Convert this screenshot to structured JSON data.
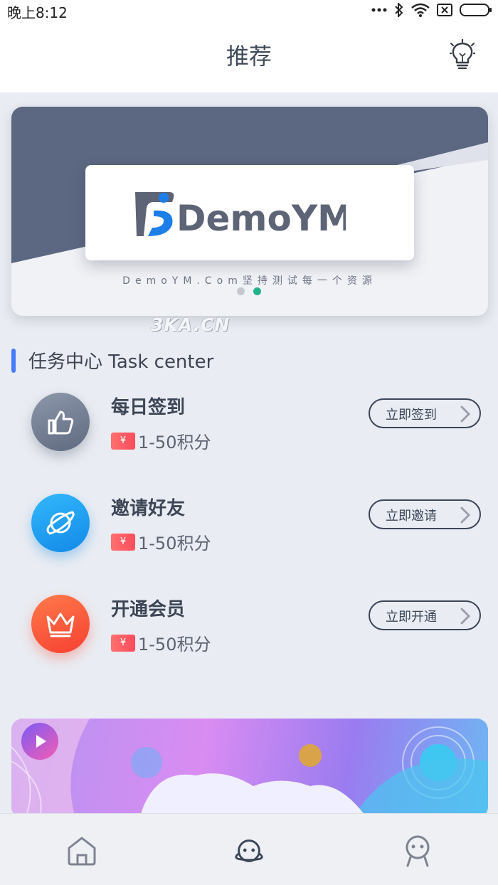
{
  "status_bar": {
    "time": "晚上8:12",
    "icons": [
      "more-dots-icon",
      "bluetooth-icon",
      "wifi-icon",
      "sim-off-icon",
      "battery-icon"
    ]
  },
  "header": {
    "title": "推荐",
    "action_icon": "lightbulb-icon"
  },
  "banner": {
    "logo_text": "DemoYM",
    "tagline": "DemoYM.Com坚持测试每一个资源",
    "page_count": 2,
    "active_page": 2
  },
  "watermark": "3KA.CN",
  "task_center": {
    "title": "任务中心 Task center",
    "tasks": [
      {
        "name": "每日签到",
        "ticket_symbol": "¥",
        "reward": "1-50积分",
        "button": "立即签到",
        "icon": "thumbs-up-icon",
        "color": "#7a8599"
      },
      {
        "name": "邀请好友",
        "ticket_symbol": "¥",
        "reward": "1-50积分",
        "button": "立即邀请",
        "icon": "planet-icon",
        "color": "#1f9cf0"
      },
      {
        "name": "开通会员",
        "ticket_symbol": "¥",
        "reward": "1-50积分",
        "button": "立即开通",
        "icon": "crown-icon",
        "color": "#ff5a43"
      }
    ]
  },
  "ad_banner": {
    "icon": "play-icon"
  },
  "tab_bar": {
    "tabs": [
      {
        "icon": "home-icon",
        "active": false
      },
      {
        "icon": "planet-face-icon",
        "active": true
      },
      {
        "icon": "profile-icon",
        "active": false
      }
    ]
  },
  "colors": {
    "accent": "#4a7bf7",
    "dot_active": "#22b38d",
    "text_dark": "#3c4656"
  }
}
